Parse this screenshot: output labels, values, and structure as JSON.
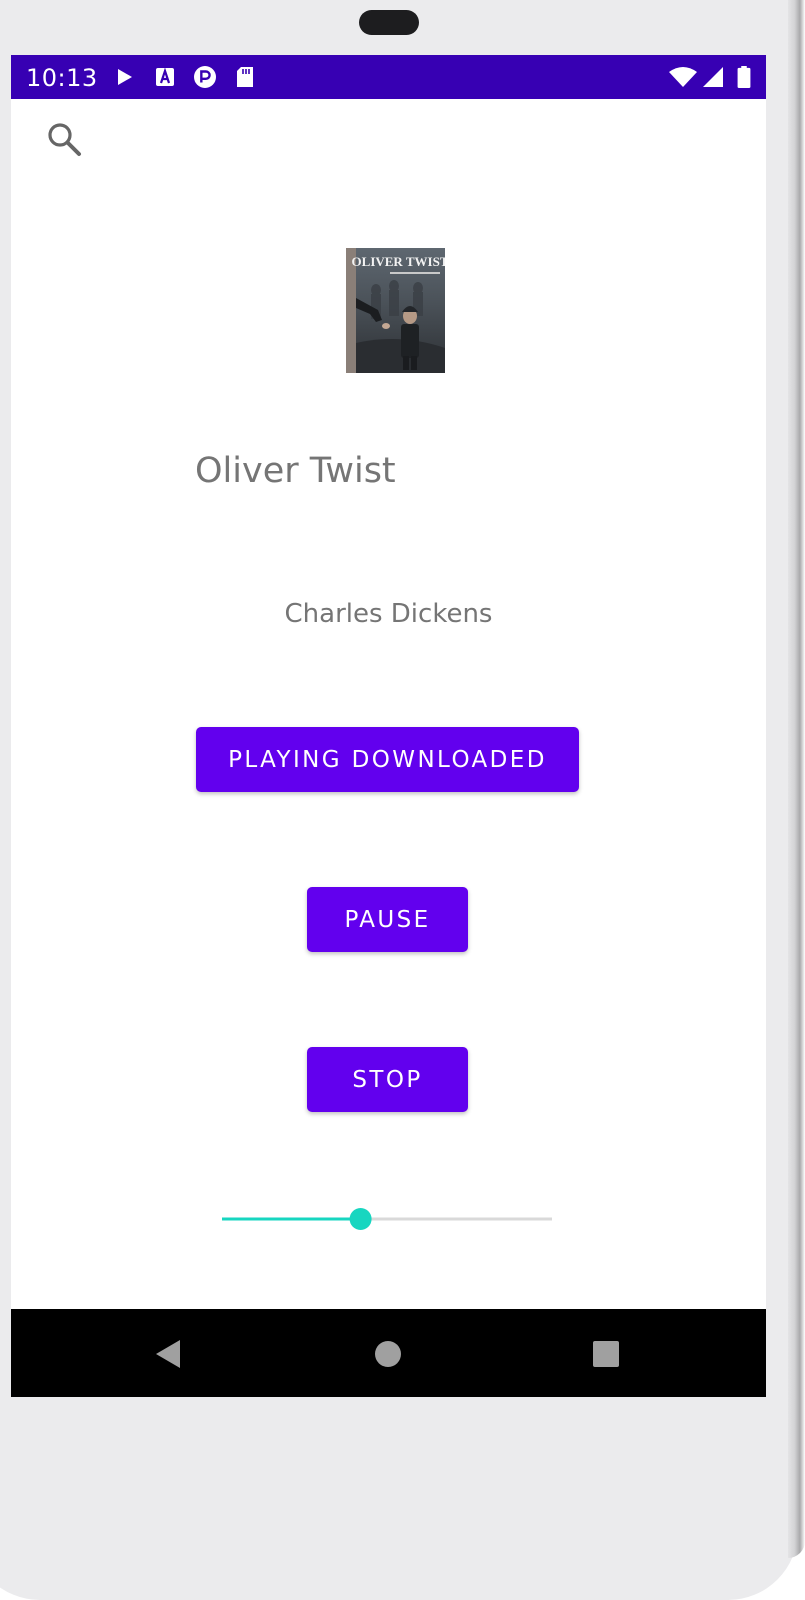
{
  "status_bar": {
    "time": "10:13",
    "background": "#3700b3",
    "left_icons": [
      "play-icon",
      "a-box-icon",
      "p-circle-icon",
      "sd-card-icon"
    ],
    "right_icons": [
      "wifi-icon",
      "signal-icon",
      "battery-icon"
    ]
  },
  "toolbar": {
    "search_icon": "search-icon"
  },
  "book": {
    "cover_title": "OLIVER TWIST",
    "title": "Oliver Twist",
    "author": "Charles Dickens"
  },
  "controls": {
    "play_label": "PLAYING DOWNLOADED",
    "pause_label": "PAUSE",
    "stop_label": "STOP",
    "button_color": "#6200ee"
  },
  "seekbar": {
    "progress": 0.42,
    "accent": "#17d6c0",
    "track": "#d9d9d9"
  },
  "navigation": {
    "back_icon": "back-triangle-icon",
    "home_icon": "home-circle-icon",
    "recents_icon": "recents-square-icon"
  }
}
